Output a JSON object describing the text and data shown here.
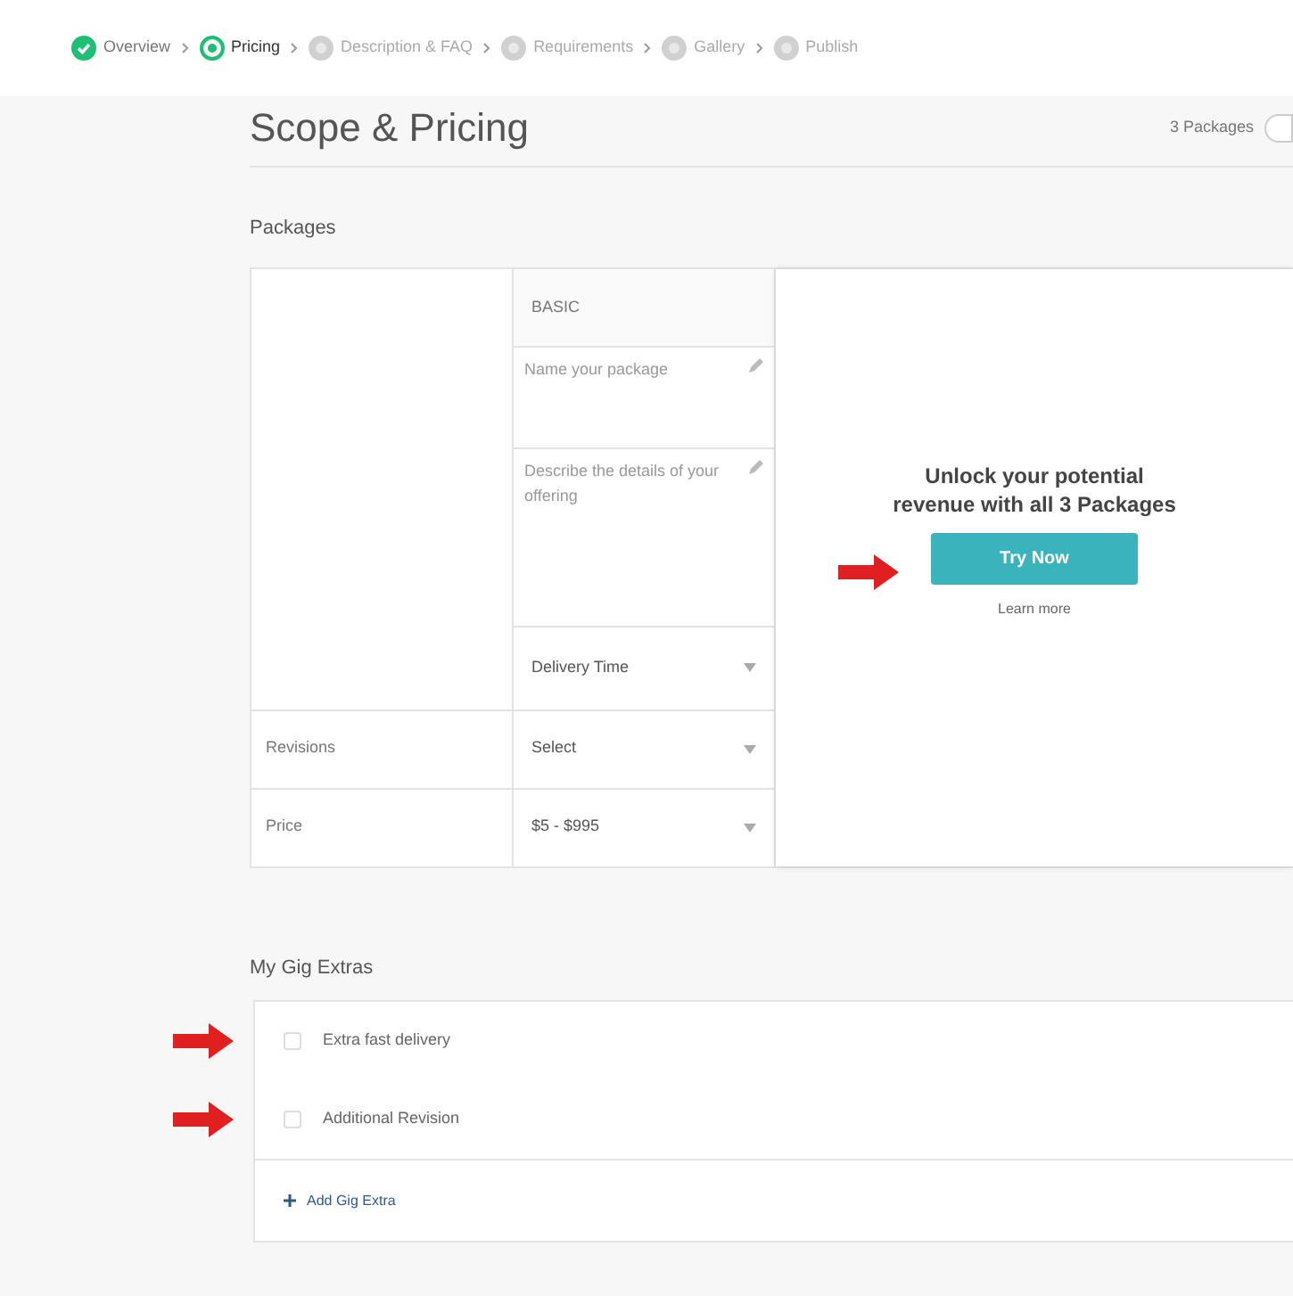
{
  "steps": [
    {
      "label": "Overview",
      "completed": true,
      "selected": false
    },
    {
      "label": "Pricing",
      "completed": false,
      "selected": true
    },
    {
      "label": "Description & FAQ",
      "completed": false,
      "selected": false
    },
    {
      "label": "Requirements",
      "completed": false,
      "selected": false
    },
    {
      "label": "Gallery",
      "completed": false,
      "selected": false
    },
    {
      "label": "Publish",
      "completed": false,
      "selected": false
    }
  ],
  "title": "Scope & Pricing",
  "packages_toggle": {
    "label": "3 Packages",
    "on": false
  },
  "packages": {
    "heading": "Packages",
    "column_header": "BASIC",
    "name_placeholder": "Name your package",
    "description_placeholder": "Describe the details of your offering",
    "rows": [
      {
        "value": "Delivery Time"
      },
      {
        "label": "Revisions",
        "value": "Select"
      },
      {
        "label": "Price",
        "value": "$5 - $995"
      }
    ],
    "upsell": {
      "headline": "Unlock your potential revenue with all 3 Packages",
      "button": "Try Now",
      "link": "Learn more"
    }
  },
  "extras": {
    "heading": "My Gig Extras",
    "items": [
      {
        "label": "Extra fast delivery",
        "checked": false
      },
      {
        "label": "Additional Revision",
        "checked": false
      }
    ],
    "add": "Add Gig Extra"
  }
}
